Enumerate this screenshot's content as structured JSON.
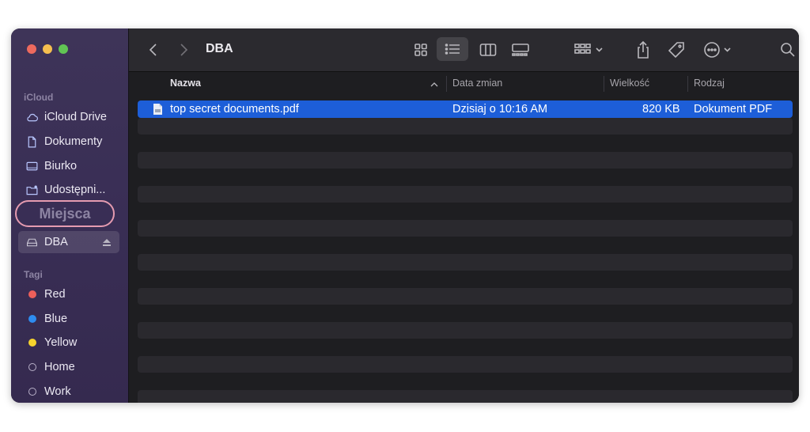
{
  "sidebar": {
    "icloud_title": "iCloud",
    "icloud_items": [
      {
        "label": "iCloud Drive",
        "icon": "cloud-icon"
      },
      {
        "label": "Dokumenty",
        "icon": "document-icon"
      },
      {
        "label": "Biurko",
        "icon": "desktop-icon"
      },
      {
        "label": "Udostępni...",
        "icon": "shared-folder-icon"
      }
    ],
    "highlight_label": "Miejsca",
    "places": [
      {
        "label": "DBA",
        "icon": "drive-icon",
        "selected": true
      }
    ],
    "tags_title": "Tagi",
    "tags": [
      {
        "label": "Red",
        "color": "#ed5f5a"
      },
      {
        "label": "Blue",
        "color": "#2e8cf0"
      },
      {
        "label": "Yellow",
        "color": "#f6d32d"
      },
      {
        "label": "Home",
        "color": ""
      },
      {
        "label": "Work",
        "color": ""
      }
    ]
  },
  "toolbar": {
    "title": "DBA",
    "icons": [
      "back-icon",
      "forward-icon",
      "icon-view-icon",
      "list-view-icon",
      "column-view-icon",
      "gallery-view-icon",
      "group-icon",
      "share-icon",
      "tag-icon",
      "more-icon",
      "search-icon"
    ]
  },
  "columns": {
    "name": "Nazwa",
    "date": "Data zmian",
    "size": "Wielkość",
    "kind": "Rodzaj"
  },
  "files": [
    {
      "name": "top secret documents.pdf",
      "date": "Dzisiaj o 10:16 AM",
      "size": "820 KB",
      "kind": "Dokument PDF",
      "icon": "pdf-file-icon"
    }
  ],
  "colors": {
    "accent": "#1d5ed8",
    "highlight_ring": "#e59bb0"
  }
}
